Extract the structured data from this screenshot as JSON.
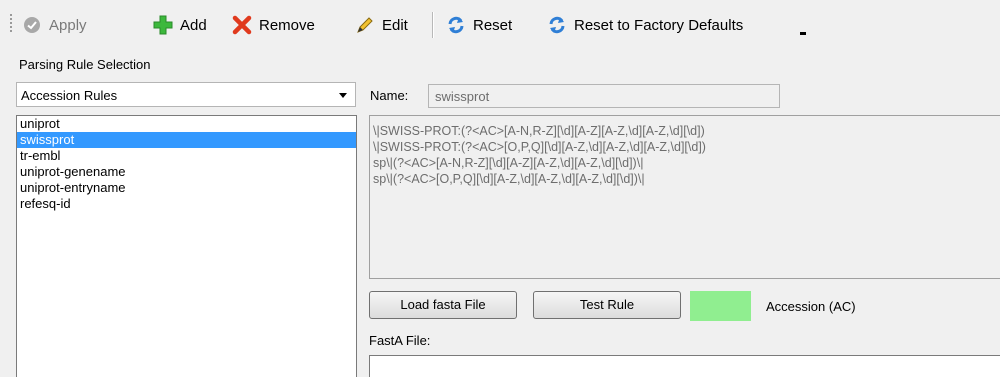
{
  "toolbar": {
    "apply_label": "Apply",
    "add_label": "Add",
    "remove_label": "Remove",
    "edit_label": "Edit",
    "reset_label": "Reset",
    "reset_factory_label": "Reset to Factory Defaults"
  },
  "selection": {
    "section_label": "Parsing Rule Selection",
    "combo_value": "Accession Rules",
    "items": [
      "uniprot",
      "swissprot",
      "tr-embl",
      "uniprot-genename",
      "uniprot-entryname",
      "refesq-id"
    ],
    "selected_index": 1
  },
  "detail": {
    "name_label": "Name:",
    "name_value": "swissprot",
    "rules": [
      "\\|SWISS-PROT:(?<AC>[A-N,R-Z][\\d][A-Z][A-Z,\\d][A-Z,\\d][\\d])",
      "\\|SWISS-PROT:(?<AC>[O,P,Q][\\d][A-Z,\\d][A-Z,\\d][A-Z,\\d][\\d])",
      "sp\\|(?<AC>[A-N,R-Z][\\d][A-Z][A-Z,\\d][A-Z,\\d][\\d])\\|",
      "sp\\|(?<AC>[O,P,Q][\\d][A-Z,\\d][A-Z,\\d][A-Z,\\d][\\d])\\|"
    ],
    "load_button": "Load fasta File",
    "test_button": "Test Rule",
    "legend_label": "Accession (AC)",
    "legend_color": "#90ee90",
    "fasta_label": "FastA File:"
  }
}
